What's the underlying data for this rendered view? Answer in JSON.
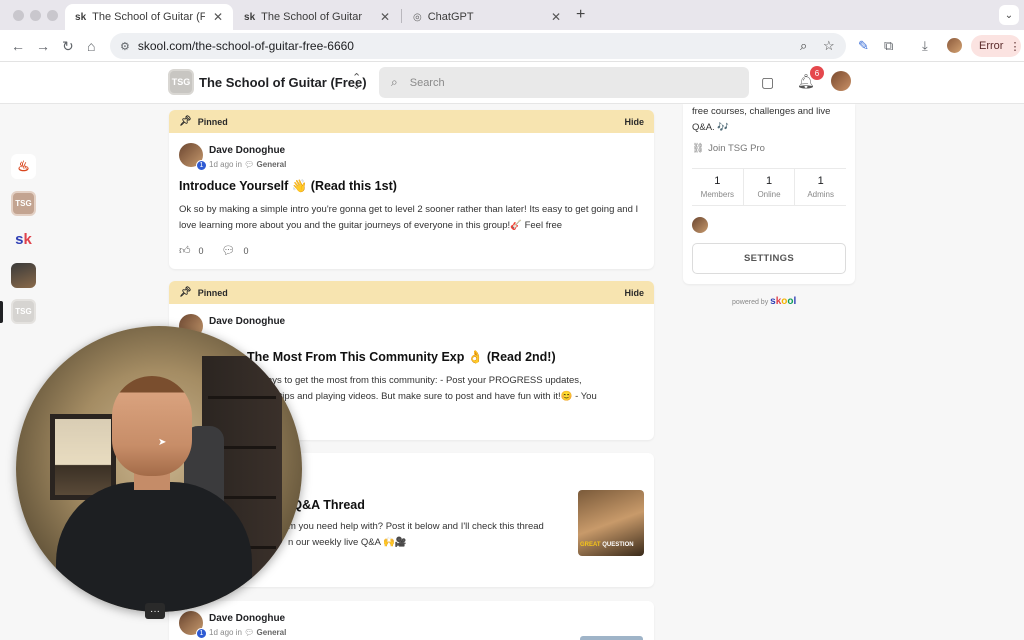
{
  "browser": {
    "tabs": [
      {
        "label": "The School of Guitar (Free)",
        "active": true
      },
      {
        "label": "The School of Guitar",
        "active": false
      },
      {
        "label": "ChatGPT",
        "active": false
      }
    ],
    "url": "skool.com/the-school-of-guitar-free-6660",
    "error_label": "Error"
  },
  "header": {
    "group_logo": "TSG",
    "group_name": "The School of Guitar (Free)",
    "search_placeholder": "Search",
    "notification_count": "6"
  },
  "rail": {
    "tsg_label": "TSG",
    "tsg2_label": "TSG"
  },
  "posts": [
    {
      "pinned_label": "Pinned",
      "hide_label": "Hide",
      "author": "Dave Donoghue",
      "level": "1",
      "time": "1d ago in",
      "category": "General",
      "title": "Introduce Yourself 👋 (Read this 1st)",
      "body": "Ok so by making a simple intro you're gonna get to level 2 sooner rather than later! Its easy to get going and I love learning more about you and the guitar journeys of everyone in this group!🎸 Feel free",
      "likes": "0",
      "comments": "0"
    },
    {
      "pinned_label": "Pinned",
      "hide_label": "Hide",
      "author": "Dave Donoghue",
      "title_visible": "The Most From This Community Exp 👌 (Read 2nd!)",
      "body_line1": "ays to get the most from this community: - Post your PROGRESS updates,",
      "body_line2": "ts, tips and playing videos. But make sure to post and have fun with it!😊 - You"
    },
    {
      "category_fragment": "ents",
      "title_visible": "y Q&A Thread",
      "body_line1": "m you need help with? Post it below and I'll check this thread",
      "body_line2": "n our weekly live Q&A 🙌🎥",
      "thumb_caption_1": "GREAT",
      "thumb_caption_2": "QUESTION"
    },
    {
      "author": "Dave Donoghue",
      "level": "1",
      "time": "1d ago in",
      "category": "General"
    }
  ],
  "sidebar": {
    "description": "free courses, challenges and live Q&A. 🎶",
    "join_label": "Join TSG Pro",
    "stats": [
      {
        "value": "1",
        "label": "Members"
      },
      {
        "value": "1",
        "label": "Online"
      },
      {
        "value": "1",
        "label": "Admins"
      }
    ],
    "settings_label": "SETTINGS",
    "powered_by": "powered by"
  },
  "webcam": {
    "more_label": "···"
  },
  "colors": {
    "pinned_bar": "#f7e4b0",
    "badge_red": "#e5484d",
    "level_blue": "#2f5bd3"
  }
}
